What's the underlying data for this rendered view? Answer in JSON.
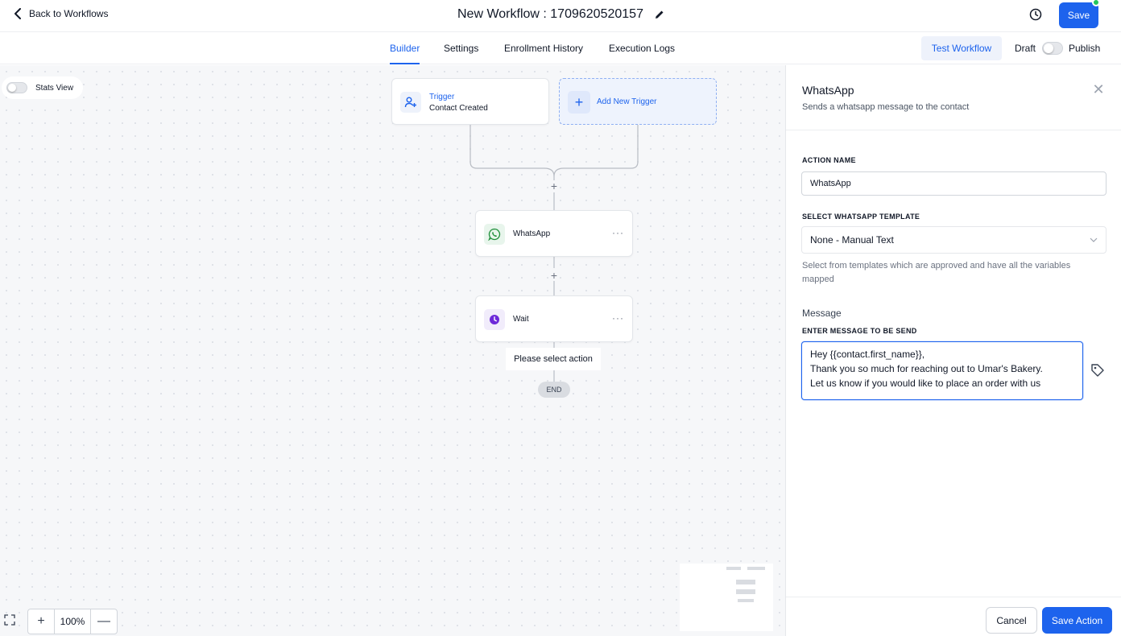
{
  "header": {
    "back_label": "Back to Workflows",
    "workflow_title": "New Workflow : 1709620520157",
    "save_label": "Save"
  },
  "tabs": [
    {
      "label": "Builder",
      "active": true
    },
    {
      "label": "Settings",
      "active": false
    },
    {
      "label": "Enrollment History",
      "active": false
    },
    {
      "label": "Execution Logs",
      "active": false
    }
  ],
  "toolbar": {
    "test_label": "Test Workflow",
    "draft_label": "Draft",
    "publish_label": "Publish"
  },
  "canvas": {
    "stats_label": "Stats View",
    "trigger": {
      "title": "Trigger",
      "subtitle": "Contact Created"
    },
    "add_trigger_label": "Add New Trigger",
    "actions": [
      {
        "label": "WhatsApp",
        "icon": "whatsapp-icon"
      },
      {
        "label": "Wait",
        "icon": "clock-icon"
      }
    ],
    "more_label": "···",
    "select_action_label": "Please select action",
    "end_label": "END",
    "zoom_level": "100%"
  },
  "panel": {
    "title": "WhatsApp",
    "subtitle": "Sends a whatsapp message to the contact",
    "action_name_label": "ACTION NAME",
    "action_name_value": "WhatsApp",
    "template_label": "SELECT WHATSAPP TEMPLATE",
    "template_value": "None - Manual Text",
    "template_help": "Select from templates which are approved and have all the variables mapped",
    "message_heading": "Message",
    "message_label": "ENTER MESSAGE TO BE SEND",
    "message_value": "Hey {{contact.first_name}},\nThank you so much for reaching out to Umar's Bakery.\nLet us know if you would like to place an order with us",
    "cancel_label": "Cancel",
    "save_label": "Save Action"
  },
  "colors": {
    "primary": "#1d63ed",
    "whatsapp": "#25a244",
    "wait": "#6d28d9"
  }
}
